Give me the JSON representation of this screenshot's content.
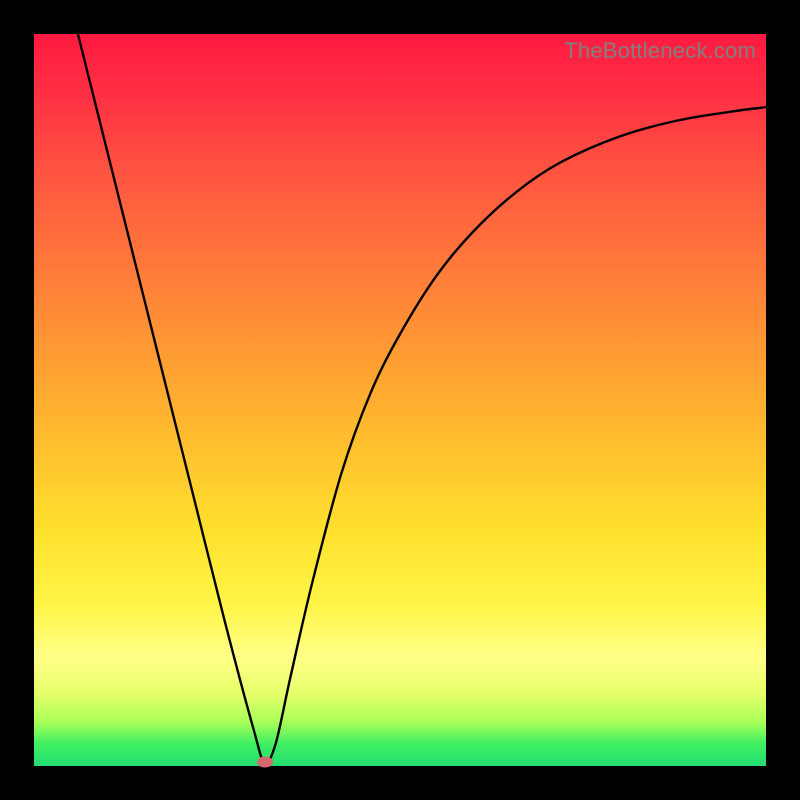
{
  "watermark": "TheBottleneck.com",
  "colors": {
    "frame": "#000000",
    "curve": "#000000",
    "min_marker": "#d46a6e"
  },
  "chart_data": {
    "type": "line",
    "title": "",
    "xlabel": "",
    "ylabel": "",
    "xlim": [
      0,
      100
    ],
    "ylim": [
      0,
      100
    ],
    "grid": false,
    "legend": false,
    "series": [
      {
        "name": "bottleneck-curve",
        "x": [
          6,
          10,
          14,
          18,
          22,
          26,
          30,
          31.5,
          33,
          35,
          38,
          42,
          46,
          50,
          55,
          60,
          66,
          72,
          80,
          88,
          96,
          100
        ],
        "y": [
          100,
          84,
          68,
          52,
          36,
          20,
          5,
          0.5,
          3,
          12,
          25,
          40,
          51,
          59,
          67,
          73,
          78.5,
          82.5,
          86,
          88.2,
          89.5,
          90
        ]
      }
    ],
    "annotations": [
      {
        "type": "marker",
        "name": "minimum",
        "x": 31.5,
        "y": 0.5
      }
    ]
  }
}
